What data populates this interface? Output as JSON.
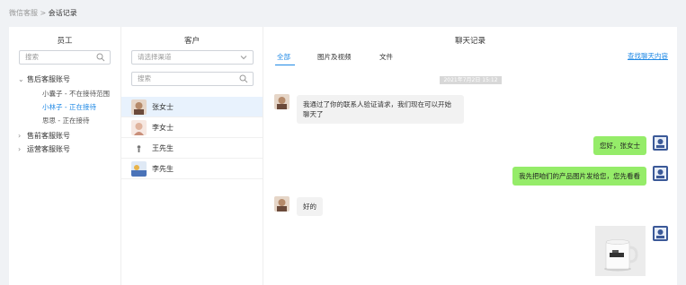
{
  "breadcrumb": {
    "parent": "微信客服",
    "sep": ">",
    "current": "会话记录"
  },
  "staff": {
    "title": "员工",
    "search_placeholder": "搜索",
    "groups": [
      {
        "label": "售后客服账号",
        "expanded": true,
        "children": [
          {
            "label": "小囊子 - 不在接待范围"
          },
          {
            "label": "小林子 - 正在接待",
            "active": true
          },
          {
            "label": "思思 - 正在接待"
          }
        ]
      },
      {
        "label": "售前客服账号",
        "expanded": false
      },
      {
        "label": "运营客服账号",
        "expanded": false
      }
    ]
  },
  "customers": {
    "title": "客户",
    "channel_placeholder": "请选择渠道",
    "search_placeholder": "搜索",
    "items": [
      {
        "name": "张女士",
        "selected": true
      },
      {
        "name": "李女士"
      },
      {
        "name": "王先生"
      },
      {
        "name": "李先生"
      }
    ]
  },
  "chat": {
    "title": "聊天记录",
    "tabs": [
      {
        "label": "全部",
        "active": true
      },
      {
        "label": "图片及视频"
      },
      {
        "label": "文件"
      }
    ],
    "find_link": "查找聊天内容",
    "timestamp": "2021年7月2日 15:12",
    "messages": [
      {
        "side": "left",
        "text": "我通过了你的联系人验证请求，我们现在可以开始聊天了"
      },
      {
        "side": "right",
        "text": "您好，张女士"
      },
      {
        "side": "right",
        "text": "我先把咱们的产品图片发给您，您先看看"
      },
      {
        "side": "left",
        "text": "好的"
      },
      {
        "side": "right",
        "type": "image"
      }
    ]
  },
  "colors": {
    "accent": "#1e88e5",
    "bubble_right": "#95ec69",
    "bubble_left": "#f2f2f2",
    "selected_row": "#e8f2fd"
  },
  "icons": {
    "search": "search-icon",
    "dropdown": "chevron-down-icon",
    "expanded": "caret-down-icon",
    "collapsed": "caret-right-icon"
  }
}
